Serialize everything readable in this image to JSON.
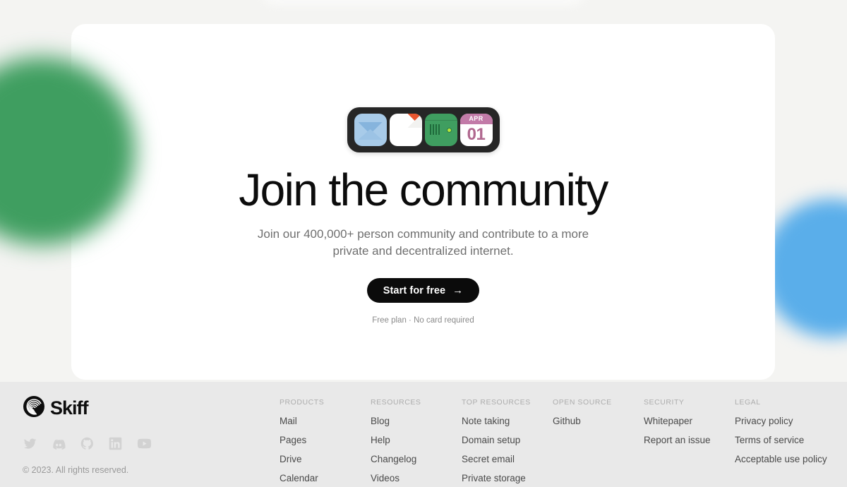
{
  "hero": {
    "headline": "Join the community",
    "subhead": "Join our 400,000+ person community and contribute to a more private and decentralized internet.",
    "cta_label": "Start for free",
    "cta_arrow": "→",
    "cta_note": "Free plan · No card required",
    "app_icons": [
      {
        "name": "mail-app-icon",
        "label": "Mail"
      },
      {
        "name": "pages-app-icon",
        "label": "Pages"
      },
      {
        "name": "drive-app-icon",
        "label": "Drive"
      },
      {
        "name": "calendar-app-icon",
        "label": "Calendar",
        "month": "APR",
        "day": "01"
      }
    ]
  },
  "footer": {
    "brand_name": "Skiff",
    "copyright": "© 2023. All rights reserved.",
    "socials": [
      {
        "name": "twitter-icon",
        "label": "Twitter"
      },
      {
        "name": "discord-icon",
        "label": "Discord"
      },
      {
        "name": "github-icon",
        "label": "Github"
      },
      {
        "name": "linkedin-icon",
        "label": "LinkedIn"
      },
      {
        "name": "youtube-icon",
        "label": "YouTube"
      }
    ],
    "columns": [
      {
        "title": "PRODUCTS",
        "links": [
          "Mail",
          "Pages",
          "Drive",
          "Calendar"
        ]
      },
      {
        "title": "RESOURCES",
        "links": [
          "Blog",
          "Help",
          "Changelog",
          "Videos"
        ]
      },
      {
        "title": "TOP RESOURCES",
        "links": [
          "Note taking",
          "Domain setup",
          "Secret email",
          "Private storage"
        ]
      },
      {
        "title": "OPEN SOURCE",
        "links": [
          "Github"
        ]
      },
      {
        "title": "SECURITY",
        "links": [
          "Whitepaper",
          "Report an issue"
        ]
      },
      {
        "title": "LEGAL",
        "links": [
          "Privacy policy",
          "Terms of service",
          "Acceptable use policy"
        ]
      }
    ]
  },
  "colors": {
    "page_background": "#f4f4f2",
    "card_background": "#ffffff",
    "footer_background": "#e9e9e9",
    "accent_green": "#3f9e60",
    "accent_blue": "#5aaeea",
    "cta_background": "#0b0b0b",
    "calendar_accent": "#c27ba8",
    "pages_accent": "#e8552e"
  }
}
